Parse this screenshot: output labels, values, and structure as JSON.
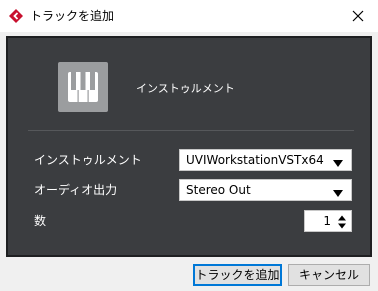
{
  "window": {
    "title": "トラックを追加"
  },
  "header": {
    "instrument_heading": "インストゥルメント"
  },
  "form": {
    "instrument_label": "インストゥルメント",
    "instrument_value": "UVIWorkstationVSTx64",
    "audio_output_label": "オーディオ出力",
    "audio_output_value": "Stereo Out",
    "count_label": "数",
    "count_value": "1"
  },
  "buttons": {
    "add_track": "トラックを追加",
    "cancel": "キャンセル"
  },
  "icons": {
    "app": "cubase-logo-icon",
    "close": "close-icon",
    "instrument": "piano-keys-icon",
    "dropdown": "dropdown-arrow-icon",
    "stepper": "stepper-arrows-icon"
  },
  "colors": {
    "panel_bg": "#3b3d40",
    "accent_red": "#c8102e",
    "focus_blue": "#0078d7"
  }
}
